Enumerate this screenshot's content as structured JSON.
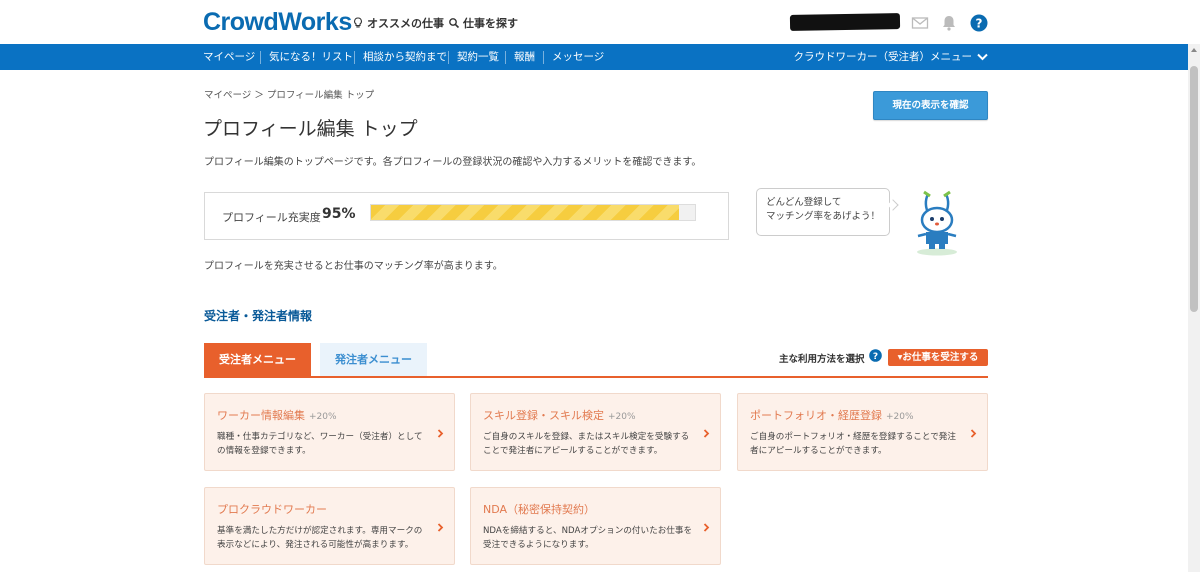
{
  "header": {
    "logo": "CrowdWorks",
    "links": [
      {
        "label": "オススメの仕事",
        "icon": "lightbulb-icon"
      },
      {
        "label": "仕事を探す",
        "icon": "search-icon"
      }
    ]
  },
  "nav": {
    "items": [
      "マイページ",
      "気になる！リスト",
      "相談から契約まで",
      "契約一覧",
      "報酬",
      "メッセージ"
    ],
    "menu_label": "クラウドワーカー（受注者）メニュー"
  },
  "page": {
    "breadcrumb": "マイページ ＞ プロフィール編集 トップ",
    "title": "プロフィール編集 トップ",
    "confirm_button": "現在の表示を確認",
    "description": "プロフィール編集のトップページです。各プロフィールの登録状況の確認や入力するメリットを確認できます。",
    "note": "プロフィールを充実させるとお仕事のマッチング率が高まります。"
  },
  "profile": {
    "label": "プロフィール充実度",
    "percent_label": "95%",
    "percent": 95,
    "bubble_line1": "どんどん登録して",
    "bubble_line2": "マッチング率をあげよう！"
  },
  "section": {
    "title": "受注者・発注者情報",
    "tab_worker": "受注者メニュー",
    "tab_client": "発注者メニュー",
    "usage_label": "主な利用方法を選択",
    "job_button": "▾お仕事を受注する"
  },
  "cards": [
    {
      "title": "ワーカー情報編集",
      "pct": "+20%",
      "desc": "職種・仕事カテゴリなど、ワーカー（受注者）としての情報を登録できます。"
    },
    {
      "title": "スキル登録・スキル検定",
      "pct": "+20%",
      "desc": "ご自身のスキルを登録、またはスキル検定を受験することで発注者にアピールすることができます。"
    },
    {
      "title": "ポートフォリオ・経歴登録",
      "pct": "+20%",
      "desc": "ご自身のポートフォリオ・経歴を登録することで発注者にアピールすることができます。"
    },
    {
      "title": "プロクラウドワーカー",
      "pct": "",
      "desc": "基準を満たした方だけが認定されます。専用マークの表示などにより、発注される可能性が高まります。"
    },
    {
      "title": "NDA（秘密保持契約）",
      "pct": "",
      "desc": "NDAを締結すると、NDAオプションの付いたお仕事を受注できるようになります。"
    }
  ],
  "colors": {
    "brand_blue": "#0a72c3",
    "accent_orange": "#e8602c",
    "progress_yellow": "#f6cd3f"
  }
}
